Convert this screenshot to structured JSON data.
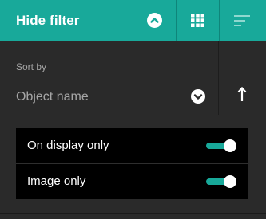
{
  "toolbar": {
    "hide_filter_label": "Hide filter",
    "hide_filter_icon": "chevron-up-circle-icon",
    "grid_view_icon": "grid-icon",
    "sort_lines_icon": "sort-lines-icon",
    "accent_color": "#18a99a"
  },
  "sort": {
    "label": "Sort by",
    "selected": "Object name",
    "dropdown_icon": "chevron-down-circle-icon",
    "direction_icon": "arrow-up-icon"
  },
  "filters": [
    {
      "label": "On display only",
      "enabled": true
    },
    {
      "label": "Image only",
      "enabled": true
    }
  ],
  "colors": {
    "background": "#2a2a2a",
    "panel": "#000000",
    "text_muted": "#a6a6a6"
  }
}
